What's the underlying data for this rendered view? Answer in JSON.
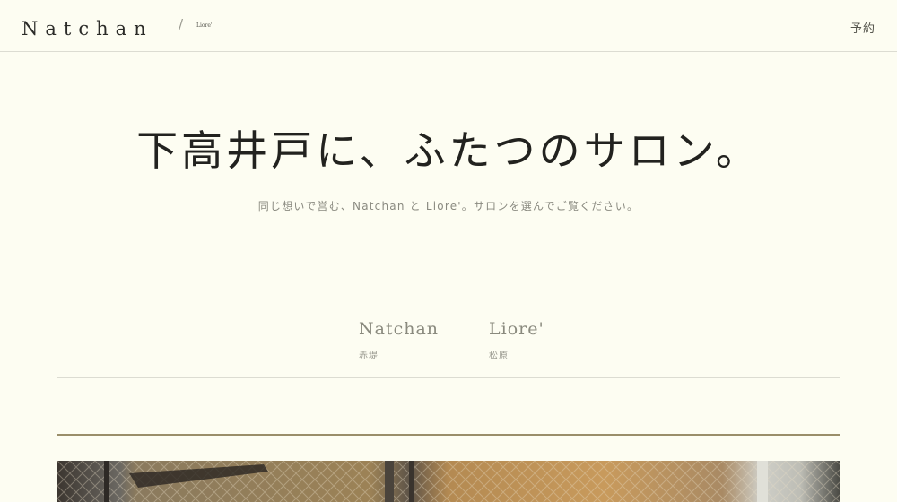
{
  "header": {
    "logo": "Natchan",
    "logo_slash": "/",
    "logo_sub": "Liore'",
    "reserve_label": "予約"
  },
  "hero": {
    "title": "下高井戸に、ふたつのサロン。",
    "subtitle": "同じ想いで営む、Natchan と Liore'。サロンを選んでご覧ください。"
  },
  "salons": [
    {
      "name": "Natchan",
      "place": "赤堤"
    },
    {
      "name": "Liore'",
      "place": "松原"
    }
  ],
  "colors": {
    "background": "#fdfdf2",
    "accent_line": "#9a8e6a",
    "divider": "#dcdcd2"
  }
}
